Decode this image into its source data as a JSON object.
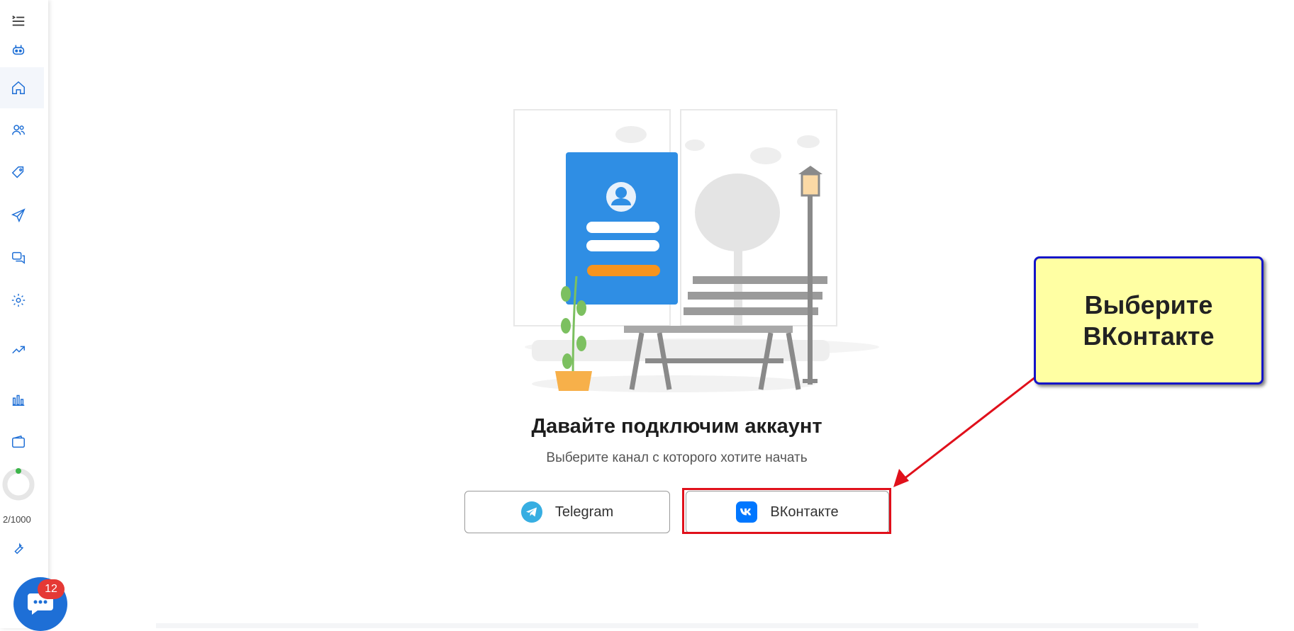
{
  "sidebar": {
    "items": [
      {
        "name": "menu-toggle-icon"
      },
      {
        "name": "bot-icon"
      },
      {
        "name": "home-icon"
      },
      {
        "name": "users-icon"
      },
      {
        "name": "tags-icon"
      },
      {
        "name": "send-icon"
      },
      {
        "name": "chats-icon"
      },
      {
        "name": "settings-icon"
      },
      {
        "name": "trend-icon"
      },
      {
        "name": "stats-icon"
      },
      {
        "name": "wallet-icon"
      },
      {
        "name": "tools-icon"
      }
    ],
    "usage_text": "2/1000",
    "usage_fraction": 0.002,
    "accent": "#1e6fd6"
  },
  "chat_widget": {
    "badge": "12"
  },
  "main": {
    "title": "Давайте подключим аккаунт",
    "subtitle": "Выберите канал с которого хотите начать",
    "buttons": {
      "telegram": "Telegram",
      "vkontakte": "ВКонтакте"
    }
  },
  "annotation": {
    "callout_line1": "Выберите",
    "callout_line2": "ВКонтакте",
    "highlight_color": "#e0101b",
    "callout_bg": "#ffffa3"
  }
}
